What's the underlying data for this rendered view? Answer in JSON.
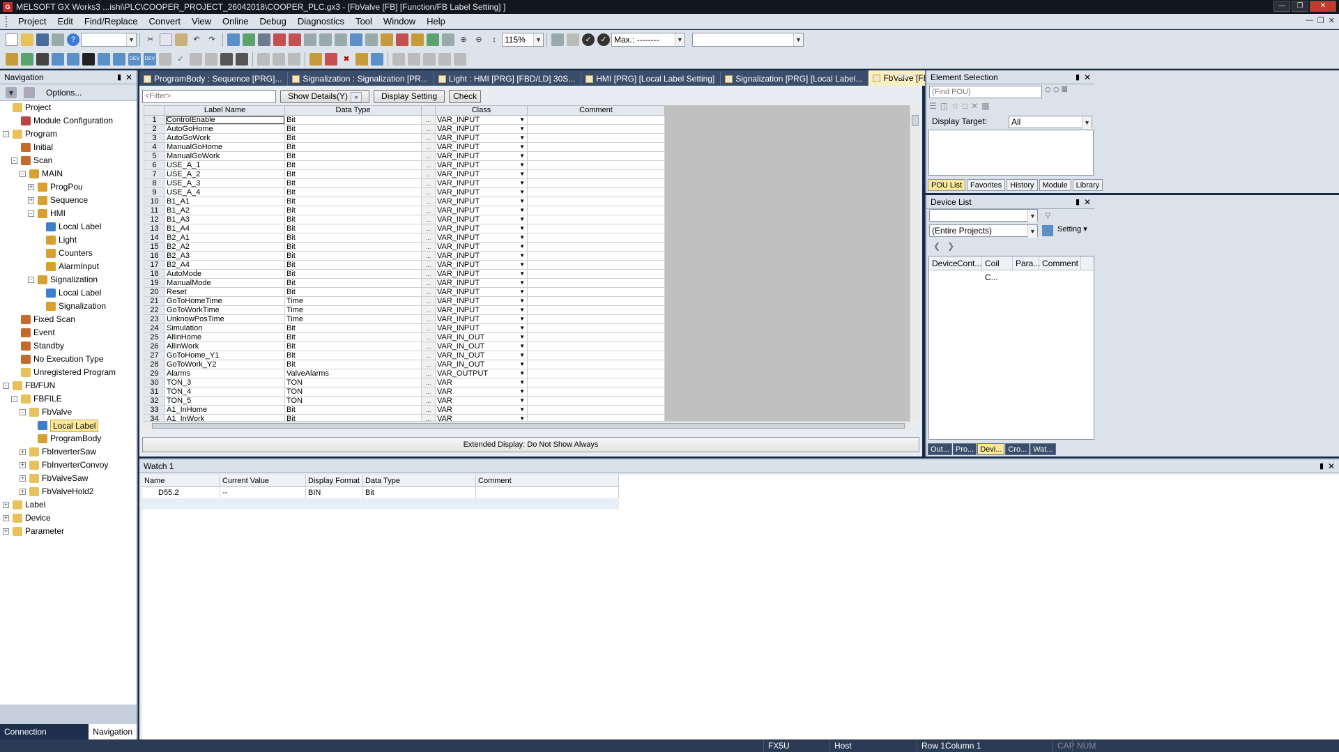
{
  "window": {
    "title": "MELSOFT GX Works3 ...ishi\\PLC\\COOPER_PROJECT_26042018\\COOPER_PLC.gx3 - [FbValve [FB] [Function/FB Label Setting] ]",
    "icon_letter": "G"
  },
  "menu": [
    "Project",
    "Edit",
    "Find/Replace",
    "Convert",
    "View",
    "Online",
    "Debug",
    "Diagnostics",
    "Tool",
    "Window",
    "Help"
  ],
  "toolbar": {
    "zoom": "115%",
    "max_label": "Max.: --------",
    "empty_combo": ""
  },
  "navigation": {
    "title": "Navigation",
    "options_label": "Options...",
    "tree": [
      {
        "label": "Project",
        "level": 0,
        "exp": "",
        "icon": "project-icon",
        "kind": "folder"
      },
      {
        "label": "Module Configuration",
        "level": 1,
        "exp": "",
        "icon": "module-config-icon",
        "kind": "mod"
      },
      {
        "label": "Program",
        "level": 0,
        "exp": "-",
        "icon": "program-folder-icon",
        "kind": "folder"
      },
      {
        "label": "Initial",
        "level": 1,
        "exp": "",
        "icon": "task-icon",
        "kind": "task"
      },
      {
        "label": "Scan",
        "level": 1,
        "exp": "-",
        "icon": "task-icon",
        "kind": "task"
      },
      {
        "label": "MAIN",
        "level": 2,
        "exp": "-",
        "icon": "program-block-icon",
        "kind": "prog"
      },
      {
        "label": "ProgPou",
        "level": 3,
        "exp": "+",
        "icon": "pou-icon",
        "kind": "prog"
      },
      {
        "label": "Sequence",
        "level": 3,
        "exp": "+",
        "icon": "pou-icon",
        "kind": "prog"
      },
      {
        "label": "HMI",
        "level": 3,
        "exp": "-",
        "icon": "pou-icon",
        "kind": "prog"
      },
      {
        "label": "Local Label",
        "level": 4,
        "exp": "",
        "icon": "local-label-icon",
        "kind": "label"
      },
      {
        "label": "Light",
        "level": 4,
        "exp": "",
        "icon": "program-body-icon",
        "kind": "prog"
      },
      {
        "label": "Counters",
        "level": 4,
        "exp": "",
        "icon": "program-body-icon",
        "kind": "prog"
      },
      {
        "label": "AlarmInput",
        "level": 4,
        "exp": "",
        "icon": "program-body-icon",
        "kind": "prog"
      },
      {
        "label": "Signalization",
        "level": 3,
        "exp": "-",
        "icon": "pou-icon",
        "kind": "prog"
      },
      {
        "label": "Local Label",
        "level": 4,
        "exp": "",
        "icon": "local-label-icon",
        "kind": "label"
      },
      {
        "label": "Signalization",
        "level": 4,
        "exp": "",
        "icon": "program-body-icon",
        "kind": "prog"
      },
      {
        "label": "Fixed Scan",
        "level": 1,
        "exp": "",
        "icon": "task-icon",
        "kind": "task"
      },
      {
        "label": "Event",
        "level": 1,
        "exp": "",
        "icon": "task-icon",
        "kind": "task"
      },
      {
        "label": "Standby",
        "level": 1,
        "exp": "",
        "icon": "task-icon",
        "kind": "task"
      },
      {
        "label": "No Execution Type",
        "level": 1,
        "exp": "",
        "icon": "task-icon",
        "kind": "task"
      },
      {
        "label": "Unregistered Program",
        "level": 1,
        "exp": "",
        "icon": "unregistered-icon",
        "kind": "folder"
      },
      {
        "label": "FB/FUN",
        "level": 0,
        "exp": "-",
        "icon": "fbfun-folder-icon",
        "kind": "folder"
      },
      {
        "label": "FBFILE",
        "level": 1,
        "exp": "-",
        "icon": "folder-icon",
        "kind": "folder"
      },
      {
        "label": "FbValve",
        "level": 2,
        "exp": "-",
        "icon": "fb-icon",
        "kind": "folder"
      },
      {
        "label": "Local Label",
        "level": 3,
        "exp": "",
        "icon": "local-label-icon",
        "kind": "label",
        "selected": true
      },
      {
        "label": "ProgramBody",
        "level": 3,
        "exp": "",
        "icon": "program-body-icon",
        "kind": "prog"
      },
      {
        "label": "FbInverterSaw",
        "level": 2,
        "exp": "+",
        "icon": "fb-icon",
        "kind": "folder"
      },
      {
        "label": "FbInverterConvoy",
        "level": 2,
        "exp": "+",
        "icon": "fb-icon",
        "kind": "folder"
      },
      {
        "label": "FbValveSaw",
        "level": 2,
        "exp": "+",
        "icon": "fb-icon",
        "kind": "folder"
      },
      {
        "label": "FbValveHold2",
        "level": 2,
        "exp": "+",
        "icon": "fb-icon",
        "kind": "folder"
      },
      {
        "label": "Label",
        "level": 0,
        "exp": "+",
        "icon": "label-folder-icon",
        "kind": "folder"
      },
      {
        "label": "Device",
        "level": 0,
        "exp": "+",
        "icon": "device-folder-icon",
        "kind": "folder"
      },
      {
        "label": "Parameter",
        "level": 0,
        "exp": "+",
        "icon": "parameter-folder-icon",
        "kind": "folder"
      }
    ],
    "bottom_tabs": [
      "Connection Destination",
      "Navigation"
    ]
  },
  "doc_tabs": [
    {
      "label": "ProgramBody : Sequence [PRG]...",
      "active": false
    },
    {
      "label": "Signalization : Signalization [PR...",
      "active": false
    },
    {
      "label": "Light : HMI [PRG] [FBD/LD] 30S...",
      "active": false
    },
    {
      "label": "HMI [PRG] [Local Label Setting]",
      "active": false
    },
    {
      "label": "Signalization [PRG] [Local Label...",
      "active": false
    },
    {
      "label": "FbValve [FB] [Function/FB Labe...",
      "active": true
    }
  ],
  "label_editor": {
    "filter_placeholder": "<Filter>",
    "show_details": "Show Details(Y)",
    "display_setting": "Display Setting",
    "check": "Check",
    "columns": [
      "Label Name",
      "Data Type",
      "Class",
      "Comment"
    ],
    "rows": [
      [
        "1",
        "ControlEnable",
        "Bit",
        "VAR_INPUT"
      ],
      [
        "2",
        "AutoGoHome",
        "Bit",
        "VAR_INPUT"
      ],
      [
        "3",
        "AutoGoWork",
        "Bit",
        "VAR_INPUT"
      ],
      [
        "4",
        "ManualGoHome",
        "Bit",
        "VAR_INPUT"
      ],
      [
        "5",
        "ManualGoWork",
        "Bit",
        "VAR_INPUT"
      ],
      [
        "6",
        "USE_A_1",
        "Bit",
        "VAR_INPUT"
      ],
      [
        "7",
        "USE_A_2",
        "Bit",
        "VAR_INPUT"
      ],
      [
        "8",
        "USE_A_3",
        "Bit",
        "VAR_INPUT"
      ],
      [
        "9",
        "USE_A_4",
        "Bit",
        "VAR_INPUT"
      ],
      [
        "10",
        "B1_A1",
        "Bit",
        "VAR_INPUT"
      ],
      [
        "11",
        "B1_A2",
        "Bit",
        "VAR_INPUT"
      ],
      [
        "12",
        "B1_A3",
        "Bit",
        "VAR_INPUT"
      ],
      [
        "13",
        "B1_A4",
        "Bit",
        "VAR_INPUT"
      ],
      [
        "14",
        "B2_A1",
        "Bit",
        "VAR_INPUT"
      ],
      [
        "15",
        "B2_A2",
        "Bit",
        "VAR_INPUT"
      ],
      [
        "16",
        "B2_A3",
        "Bit",
        "VAR_INPUT"
      ],
      [
        "17",
        "B2_A4",
        "Bit",
        "VAR_INPUT"
      ],
      [
        "18",
        "AutoMode",
        "Bit",
        "VAR_INPUT"
      ],
      [
        "19",
        "ManualMode",
        "Bit",
        "VAR_INPUT"
      ],
      [
        "20",
        "Reset",
        "Bit",
        "VAR_INPUT"
      ],
      [
        "21",
        "GoToHomeTime",
        "Time",
        "VAR_INPUT"
      ],
      [
        "22",
        "GoToWorkTime",
        "Time",
        "VAR_INPUT"
      ],
      [
        "23",
        "UnknowPosTime",
        "Time",
        "VAR_INPUT"
      ],
      [
        "24",
        "Simulation",
        "Bit",
        "VAR_INPUT"
      ],
      [
        "25",
        "AllinHome",
        "Bit",
        "VAR_IN_OUT"
      ],
      [
        "26",
        "AllinWork",
        "Bit",
        "VAR_IN_OUT"
      ],
      [
        "27",
        "GoToHome_Y1",
        "Bit",
        "VAR_IN_OUT"
      ],
      [
        "28",
        "GoToWork_Y2",
        "Bit",
        "VAR_IN_OUT"
      ],
      [
        "29",
        "Alarms",
        "ValveAlarms",
        "VAR_OUTPUT"
      ],
      [
        "30",
        "TON_3",
        "TON",
        "VAR"
      ],
      [
        "31",
        "TON_4",
        "TON",
        "VAR"
      ],
      [
        "32",
        "TON_5",
        "TON",
        "VAR"
      ],
      [
        "33",
        "A1_InHome",
        "Bit",
        "VAR"
      ],
      [
        "34",
        "A1_InWork",
        "Bit",
        "VAR"
      ]
    ],
    "extended_display": "Extended Display: Do Not Show Always"
  },
  "element_selection": {
    "title": "Element Selection",
    "find_placeholder": "(Find POU)",
    "display_target_label": "Display Target:",
    "display_target_value": "All",
    "tabs": [
      "POU List",
      "Favorites",
      "History",
      "Module",
      "Library"
    ]
  },
  "device_list": {
    "title": "Device List",
    "scope_value": "(Entire Projects)",
    "setting_label": "Setting",
    "columns": [
      "Device",
      "Cont...",
      "Coil C...",
      "Para...",
      "Comment"
    ],
    "bottom_tabs": [
      "Out...",
      "Pro...",
      "Devi...",
      "Cro...",
      "Wat..."
    ]
  },
  "watch": {
    "title": "Watch 1",
    "columns": [
      "Name",
      "Current Value",
      "Display Format",
      "Data Type",
      "Comment"
    ],
    "rows": [
      {
        "name": "D55.2",
        "value": "--",
        "format": "BIN",
        "type": "Bit",
        "comment": ""
      }
    ]
  },
  "status": {
    "plc": "FX5U",
    "connection": "Host",
    "position": "Row 1Column 1",
    "caps": "CAP",
    "num": "NUM"
  }
}
